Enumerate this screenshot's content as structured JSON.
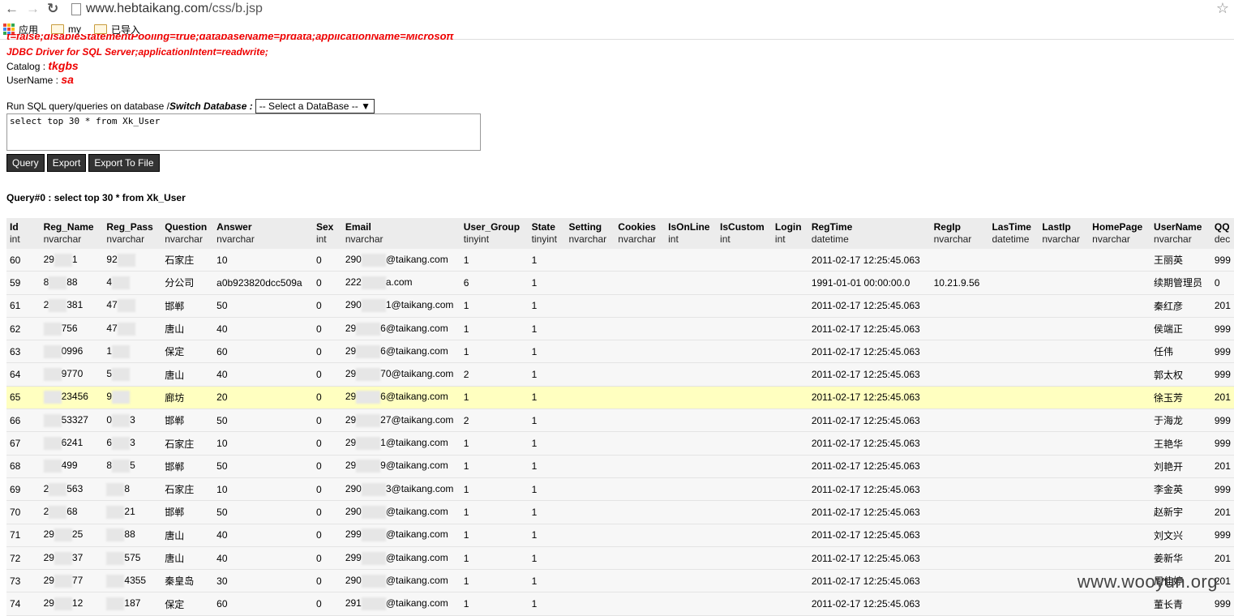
{
  "browser": {
    "url_domain": "www.hebtaikang.com",
    "url_path": "/css/b.jsp",
    "bookmarks": [
      "应用",
      "my",
      "已导入"
    ]
  },
  "info": {
    "conn_line1": "t=false;disableStatementPooling=true;databaseName=prdata;applicationName=Microsoft",
    "conn_line2": "JDBC Driver for SQL Server;applicationIntent=readwrite;",
    "catalog_label": "Catalog : ",
    "catalog_value": "tkgbs",
    "username_label": "UserName : ",
    "username_value": "sa"
  },
  "sql": {
    "run_label": "Run SQL query/queries on database / ",
    "switch_label": "Switch Database :",
    "select_value": "-- Select a DataBase --",
    "query_text": "select top 30 * from Xk_User",
    "buttons": [
      "Query",
      "Export",
      "Export To File"
    ],
    "result_label": "Query#0 : select top 30 * from Xk_User"
  },
  "table": {
    "columns": [
      {
        "name": "Id",
        "type": "int"
      },
      {
        "name": "Reg_Name",
        "type": "nvarchar"
      },
      {
        "name": "Reg_Pass",
        "type": "nvarchar"
      },
      {
        "name": "Question",
        "type": "nvarchar"
      },
      {
        "name": "Answer",
        "type": "nvarchar"
      },
      {
        "name": "Sex",
        "type": "int"
      },
      {
        "name": "Email",
        "type": "nvarchar"
      },
      {
        "name": "User_Group",
        "type": "tinyint"
      },
      {
        "name": "State",
        "type": "tinyint"
      },
      {
        "name": "Setting",
        "type": "nvarchar"
      },
      {
        "name": "Cookies",
        "type": "nvarchar"
      },
      {
        "name": "IsOnLine",
        "type": "int"
      },
      {
        "name": "IsCustom",
        "type": "int"
      },
      {
        "name": "Login",
        "type": "int"
      },
      {
        "name": "RegTime",
        "type": "datetime"
      },
      {
        "name": "RegIp",
        "type": "nvarchar"
      },
      {
        "name": "LasTime",
        "type": "datetime"
      },
      {
        "name": "LastIp",
        "type": "nvarchar"
      },
      {
        "name": "HomePage",
        "type": "nvarchar"
      },
      {
        "name": "UserName",
        "type": "nvarchar"
      },
      {
        "name": "QQ",
        "type": "dec"
      }
    ],
    "rows": [
      [
        "60",
        "29",
        "1",
        "92",
        "",
        "石家庄",
        "10",
        "0",
        "290",
        "@taikang.com",
        "1",
        "1",
        "",
        "",
        "",
        "",
        "",
        "2011-02-17 12:25:45.063",
        "",
        "",
        "",
        "",
        "王丽英",
        "999"
      ],
      [
        "59",
        "8",
        "88",
        "4",
        "",
        "分公司",
        "a0b923820dcc509a",
        "0",
        "222",
        "a.com",
        "6",
        "1",
        "",
        "",
        "",
        "",
        "",
        "1991-01-01 00:00:00.0",
        "10.21.9.56",
        "",
        "",
        "",
        "续期管理员",
        "0"
      ],
      [
        "61",
        "2",
        "381",
        "47",
        "",
        "邯郸",
        "50",
        "0",
        "290",
        "1@taikang.com",
        "1",
        "1",
        "",
        "",
        "",
        "",
        "",
        "2011-02-17 12:25:45.063",
        "",
        "",
        "",
        "",
        "秦红彦",
        "201"
      ],
      [
        "62",
        "",
        "756",
        "47",
        "",
        "唐山",
        "40",
        "0",
        "29",
        "6@taikang.com",
        "1",
        "1",
        "",
        "",
        "",
        "",
        "",
        "2011-02-17 12:25:45.063",
        "",
        "",
        "",
        "",
        "侯端正",
        "999"
      ],
      [
        "63",
        "",
        "0996",
        "1",
        "",
        "保定",
        "60",
        "0",
        "29",
        "6@taikang.com",
        "1",
        "1",
        "",
        "",
        "",
        "",
        "",
        "2011-02-17 12:25:45.063",
        "",
        "",
        "",
        "",
        "任伟",
        "999"
      ],
      [
        "64",
        "",
        "9770",
        "5",
        "",
        "唐山",
        "40",
        "0",
        "29",
        "70@taikang.com",
        "2",
        "1",
        "",
        "",
        "",
        "",
        "",
        "2011-02-17 12:25:45.063",
        "",
        "",
        "",
        "",
        "郭太权",
        "999"
      ],
      [
        "65",
        "",
        "23456",
        "9",
        "",
        "廊坊",
        "20",
        "0",
        "29",
        "6@taikang.com",
        "1",
        "1",
        "",
        "",
        "",
        "",
        "",
        "2011-02-17 12:25:45.063",
        "",
        "",
        "",
        "",
        "徐玉芳",
        "201"
      ],
      [
        "66",
        "",
        "53327",
        "0",
        "3",
        "邯郸",
        "50",
        "0",
        "29",
        "27@taikang.com",
        "2",
        "1",
        "",
        "",
        "",
        "",
        "",
        "2011-02-17 12:25:45.063",
        "",
        "",
        "",
        "",
        "于海龙",
        "999"
      ],
      [
        "67",
        "",
        "6241",
        "6",
        "3",
        "石家庄",
        "10",
        "0",
        "29",
        "1@taikang.com",
        "1",
        "1",
        "",
        "",
        "",
        "",
        "",
        "2011-02-17 12:25:45.063",
        "",
        "",
        "",
        "",
        "王艳华",
        "999"
      ],
      [
        "68",
        "",
        "499",
        "8",
        "5",
        "邯郸",
        "50",
        "0",
        "29",
        "9@taikang.com",
        "1",
        "1",
        "",
        "",
        "",
        "",
        "",
        "2011-02-17 12:25:45.063",
        "",
        "",
        "",
        "",
        "刘艳开",
        "201"
      ],
      [
        "69",
        "2",
        "563",
        "",
        "8",
        "石家庄",
        "10",
        "0",
        "290",
        "3@taikang.com",
        "1",
        "1",
        "",
        "",
        "",
        "",
        "",
        "2011-02-17 12:25:45.063",
        "",
        "",
        "",
        "",
        "李金英",
        "999"
      ],
      [
        "70",
        "2",
        "68",
        "",
        "21",
        "邯郸",
        "50",
        "0",
        "290",
        "@taikang.com",
        "1",
        "1",
        "",
        "",
        "",
        "",
        "",
        "2011-02-17 12:25:45.063",
        "",
        "",
        "",
        "",
        "赵新宇",
        "201"
      ],
      [
        "71",
        "29",
        "25",
        "",
        "88",
        "唐山",
        "40",
        "0",
        "299",
        "@taikang.com",
        "1",
        "1",
        "",
        "",
        "",
        "",
        "",
        "2011-02-17 12:25:45.063",
        "",
        "",
        "",
        "",
        "刘文兴",
        "999"
      ],
      [
        "72",
        "29",
        "37",
        "",
        "575",
        "唐山",
        "40",
        "0",
        "299",
        "@taikang.com",
        "1",
        "1",
        "",
        "",
        "",
        "",
        "",
        "2011-02-17 12:25:45.063",
        "",
        "",
        "",
        "",
        "姜新华",
        "201"
      ],
      [
        "73",
        "29",
        "77",
        "",
        "4355",
        "秦皇岛",
        "30",
        "0",
        "290",
        "@taikang.com",
        "1",
        "1",
        "",
        "",
        "",
        "",
        "",
        "2011-02-17 12:25:45.063",
        "",
        "",
        "",
        "",
        "周佳婷",
        "201"
      ],
      [
        "74",
        "29",
        "12",
        "",
        "187",
        "保定",
        "60",
        "0",
        "291",
        "@taikang.com",
        "1",
        "1",
        "",
        "",
        "",
        "",
        "",
        "2011-02-17 12:25:45.063",
        "",
        "",
        "",
        "",
        "董长青",
        "999"
      ]
    ]
  },
  "watermark": "www.wooyun.org"
}
